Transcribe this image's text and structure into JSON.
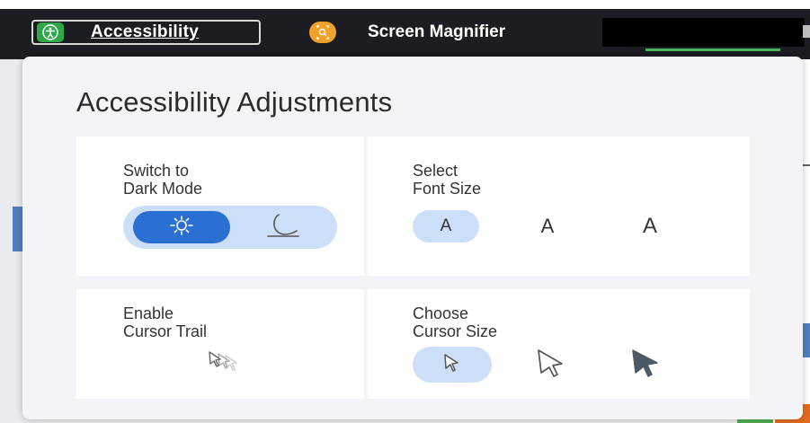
{
  "toolbar": {
    "accessibility_label": "Accessibility",
    "magnifier_label": "Screen Magnifier",
    "accessibility_icon": "person-icon",
    "magnifier_icon": "magnifier-icon"
  },
  "panel": {
    "title": "Accessibility Adjustments",
    "dark_mode": {
      "label_line1": "Switch to",
      "label_line2": "Dark Mode",
      "options": [
        "sun-icon",
        "moon-icon"
      ],
      "selected": "sun-icon"
    },
    "font_size": {
      "label_line1": "Select",
      "label_line2": "Font Size",
      "options": [
        "A",
        "A",
        "A"
      ],
      "selected_index": 0
    },
    "cursor_trail": {
      "label_line1": "Enable",
      "label_line2": "Cursor Trail",
      "icon": "cursor-trail-icon"
    },
    "cursor_size": {
      "label_line1": "Choose",
      "label_line2": "Cursor Size",
      "options": [
        "small-cursor-icon",
        "large-cursor-icon",
        "filled-cursor-icon"
      ],
      "selected_index": 0
    }
  },
  "colors": {
    "toolbar_bg": "#1b1d22",
    "accent_blue": "#2a6fd2",
    "selected_bg": "#cddff8",
    "accessibility_green": "#2ea84a",
    "magnifier_orange": "#f0a32a"
  }
}
